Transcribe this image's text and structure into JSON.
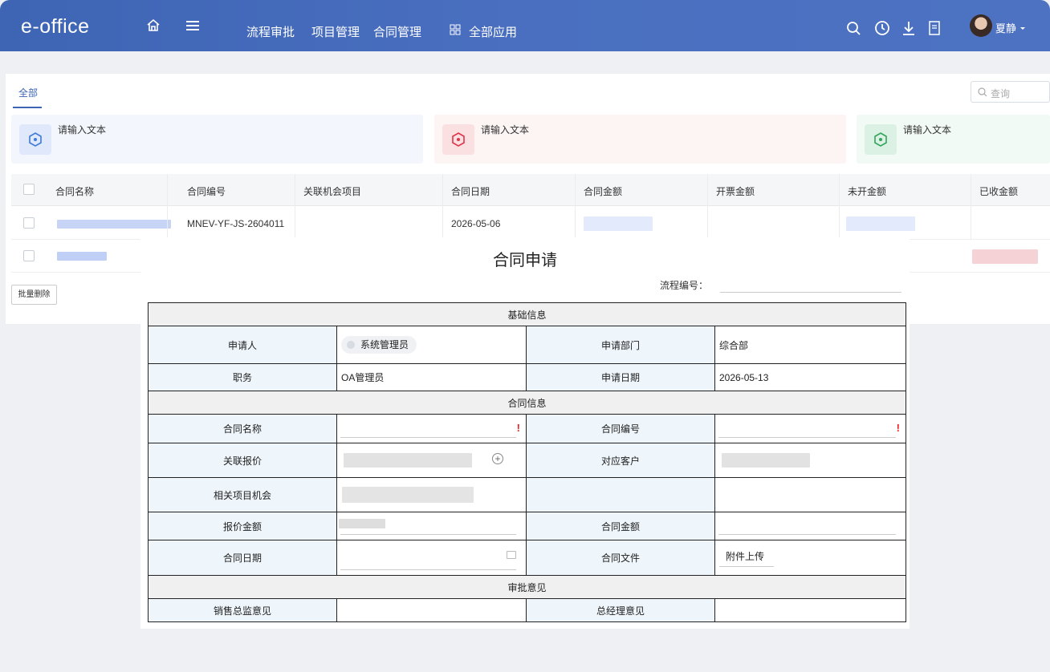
{
  "header": {
    "logo": "e-office",
    "nav": [
      "流程审批",
      "项目管理",
      "合同管理",
      "全部应用"
    ],
    "user": "夏静"
  },
  "tabs": {
    "all": "全部"
  },
  "search": {
    "placeholder": "查询"
  },
  "cards": [
    "请输入文本",
    "请输入文本",
    "请输入文本"
  ],
  "grid": {
    "columns": [
      "合同名称",
      "合同编号",
      "关联机会项目",
      "合同日期",
      "合同金额",
      "开票金额",
      "未开金额",
      "已收金额"
    ],
    "rows": [
      {
        "contract_no": "MNEV-YF-JS-2604011",
        "date": "2026-05-06"
      }
    ],
    "batch_delete": "批量删除"
  },
  "form": {
    "title": "合同申请",
    "flow_no_label": "流程编号：",
    "section_basic": "基础信息",
    "applicant_label": "申请人",
    "applicant_value": "系统管理员",
    "dept_label": "申请部门",
    "dept_value": "综合部",
    "position_label": "职务",
    "position_value": "OA管理员",
    "apply_date_label": "申请日期",
    "apply_date_value": "2026-05-13",
    "section_contract": "合同信息",
    "contract_name_label": "合同名称",
    "contract_no_label": "合同编号",
    "quote_label": "关联报价",
    "customer_label": "对应客户",
    "opportunity_label": "相关项目机会",
    "quote_amount_label": "报价金额",
    "contract_amount_label": "合同金额",
    "contract_date_label": "合同日期",
    "contract_file_label": "合同文件",
    "upload_label": "附件上传",
    "section_approval": "审批意见",
    "sales_opinion_label": "销售总监意见",
    "gm_opinion_label": "总经理意见"
  },
  "colors": {
    "brand": "#3e64b4",
    "required": "#e22222"
  }
}
